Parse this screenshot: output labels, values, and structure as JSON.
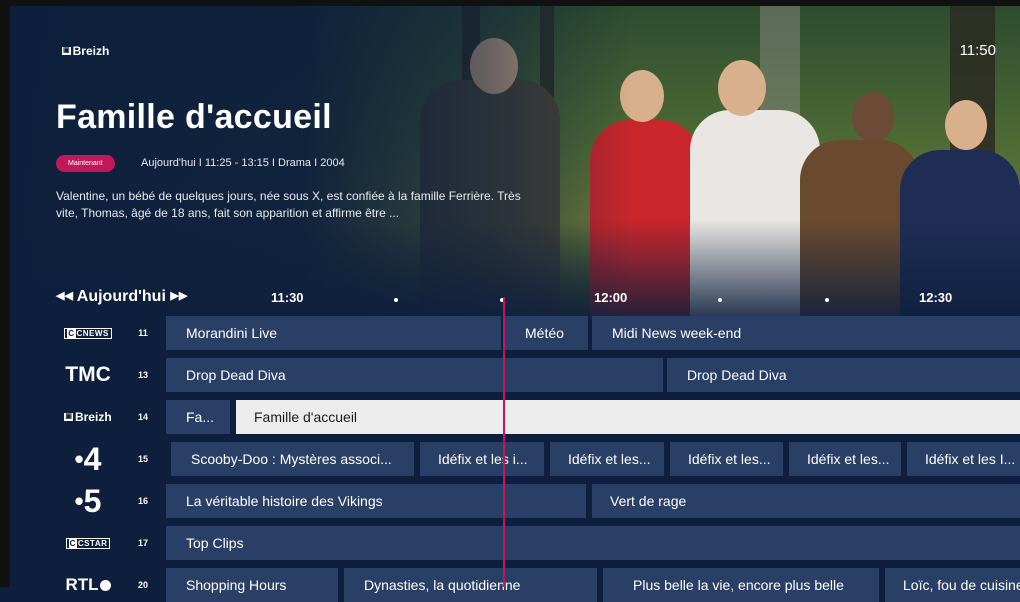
{
  "header": {
    "channel_logo": "Breizh",
    "clock": "11:50"
  },
  "program": {
    "title": "Famille d'accueil",
    "badge": "Maintenant",
    "meta": "Aujourd'hui  I  11:25 - 13:15  I  Drama  I  2004",
    "synopsis": "Valentine, un bébé de quelques jours, née sous X, est confiée à la famille Ferrière. Très vite, Thomas, âgé de 18 ans, fait son apparition et affirme être ..."
  },
  "timeline": {
    "day_label": "Aujourd'hui",
    "ticks": [
      "11:30",
      "12:00",
      "12:30"
    ]
  },
  "guide": {
    "rows": [
      {
        "channel": "CNEWS",
        "number": "11",
        "programs": [
          "Morandini Live",
          "Météo",
          "Midi News week-end"
        ]
      },
      {
        "channel": "TMC",
        "number": "13",
        "programs": [
          "Drop Dead Diva",
          "Drop Dead Diva"
        ]
      },
      {
        "channel": "Breizh",
        "number": "14",
        "programs": [
          "Fa...",
          "Famille d'accueil"
        ]
      },
      {
        "channel": "4",
        "number": "15",
        "programs": [
          "Scooby-Doo : Mystères associ...",
          "Idéfix et les i...",
          "Idéfix et les...",
          "Idéfix et les...",
          "Idéfix et les...",
          "Idéfix et les I..."
        ]
      },
      {
        "channel": "5",
        "number": "16",
        "programs": [
          "La véritable histoire des Vikings",
          "Vert de rage"
        ]
      },
      {
        "channel": "CSTAR",
        "number": "17",
        "programs": [
          "Top Clips"
        ]
      },
      {
        "channel": "RTL",
        "number": "20",
        "programs": [
          "Shopping Hours",
          "Dynasties, la quotidienne",
          "Plus belle la vie, encore plus belle",
          "Loïc, fou de cuisine"
        ]
      }
    ]
  },
  "colors": {
    "background": "#0d1f3c",
    "cell": "#2a3f66",
    "focus": "#ececec",
    "accent": "#c2185b"
  }
}
